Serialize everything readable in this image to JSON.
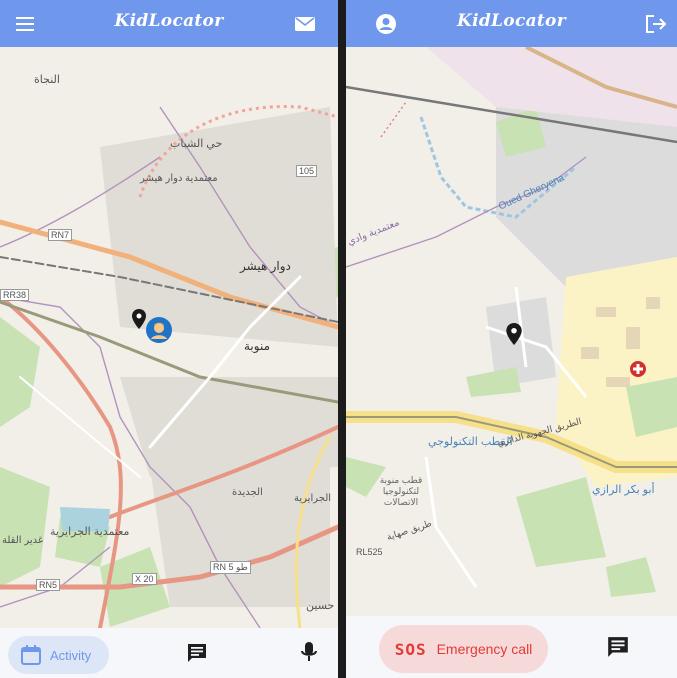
{
  "app": {
    "title": "KidLocator"
  },
  "left_screen": {
    "header": {
      "menu_icon": "menu-icon",
      "mail_icon": "mail-icon"
    },
    "map_labels": [
      {
        "text": "النجاة"
      },
      {
        "text": "حي الشباب"
      },
      {
        "text": "معتمدية دوار هيشر"
      },
      {
        "text": "دوار هيشر"
      },
      {
        "text": "منوبة"
      },
      {
        "text": "الجديدة"
      },
      {
        "text": "الجرايرية"
      },
      {
        "text": "معتمدية الجرايرية"
      },
      {
        "text": "غدير القلة"
      },
      {
        "text": "حسين"
      },
      {
        "text": "RN7"
      },
      {
        "text": "RR38"
      },
      {
        "text": "RN5"
      },
      {
        "text": "X 20"
      },
      {
        "text": "RN 5 طو"
      },
      {
        "text": "105"
      }
    ],
    "bottom": {
      "activity_label": "Activity",
      "chat_icon": "chat-icon",
      "mic_icon": "microphone-icon"
    }
  },
  "right_screen": {
    "header": {
      "account_icon": "account-icon",
      "logout_icon": "logout-icon"
    },
    "map_labels": [
      {
        "text": "Oued Gheryena"
      },
      {
        "text": "معتمدية وادي"
      },
      {
        "text": "القطب التكنولوجي"
      },
      {
        "text": "قطب منوبة لتكنولوجيا الاتصالات"
      },
      {
        "text": "أبو بكر الرازي"
      },
      {
        "text": "الطريق الجهوية الدائري"
      },
      {
        "text": "RL525"
      },
      {
        "text": "طريق صهاية"
      }
    ],
    "bottom": {
      "sos_label": "SOS",
      "emergency_label": "Emergency call",
      "chat_icon": "chat-icon"
    }
  },
  "colors": {
    "appbar": "#6f97ec",
    "sos": "#e53935",
    "sos_bg": "#f6dada",
    "activity_bg": "#dde6f7"
  }
}
